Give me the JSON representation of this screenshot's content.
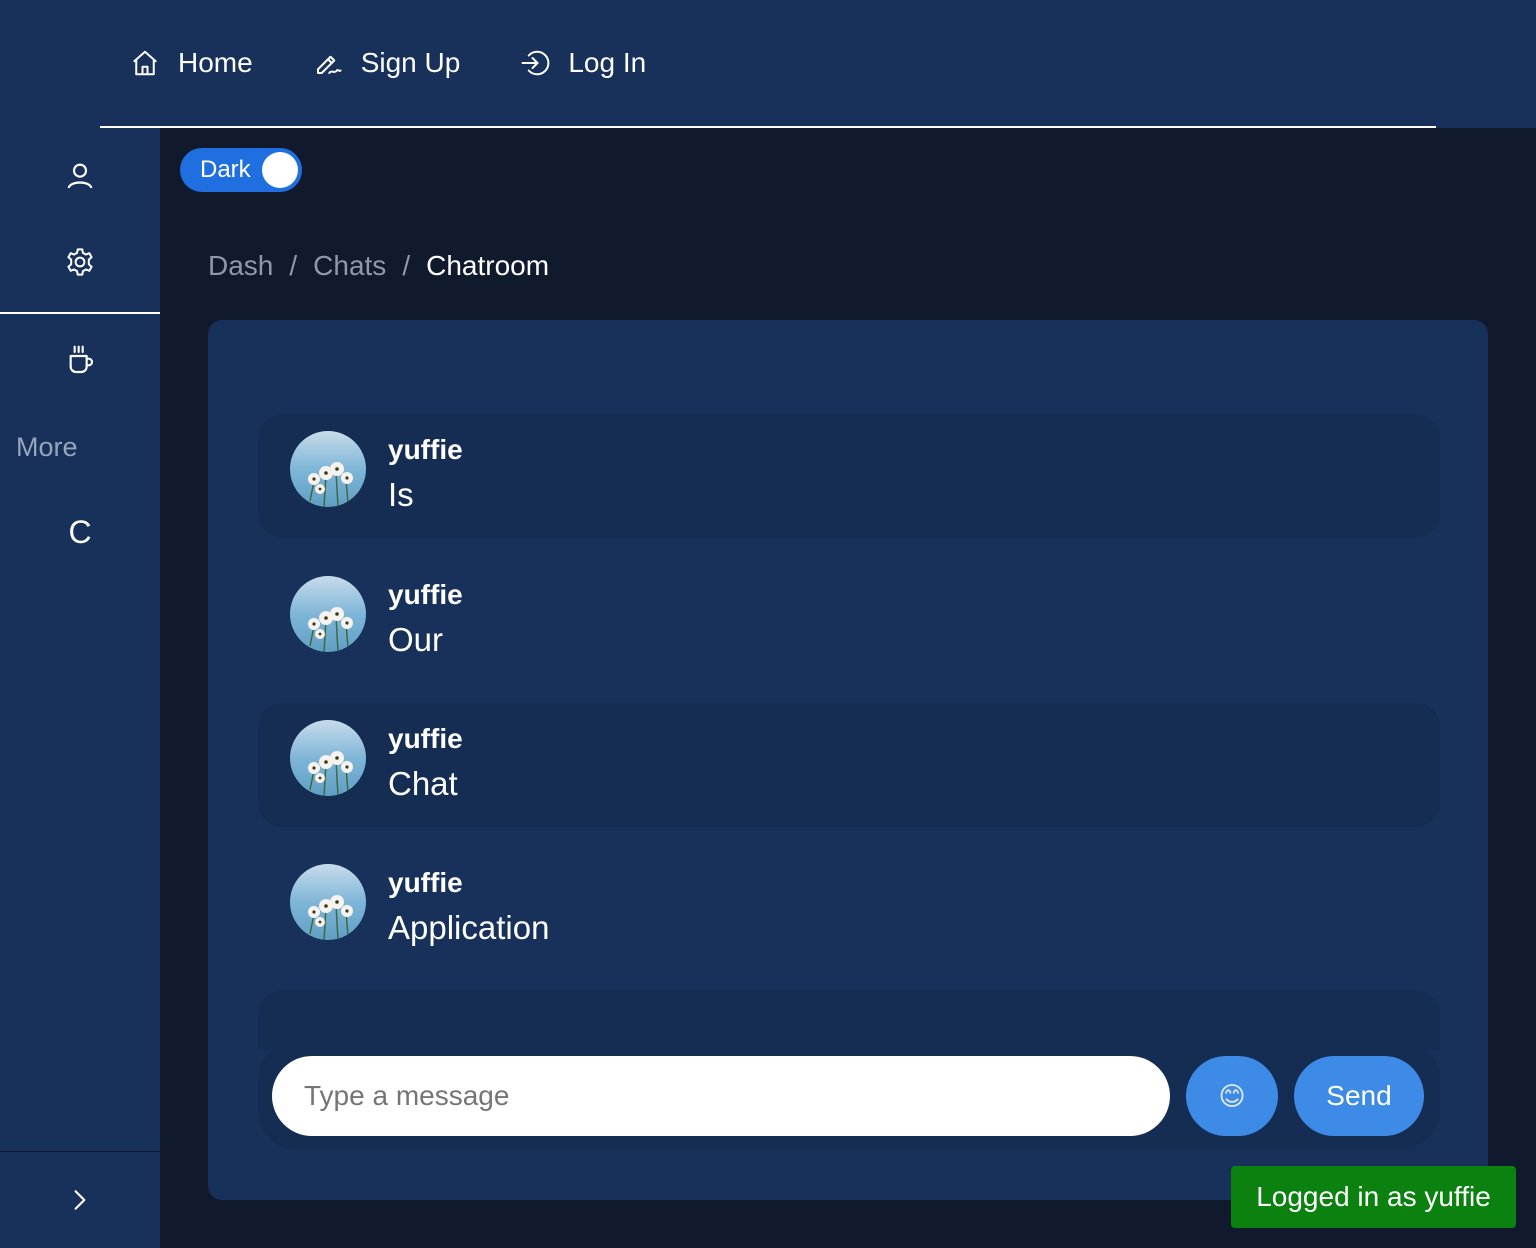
{
  "nav": {
    "items": [
      {
        "label": "Home",
        "icon": "home-icon"
      },
      {
        "label": "Sign Up",
        "icon": "signature-icon"
      },
      {
        "label": "Log In",
        "icon": "login-icon"
      }
    ]
  },
  "sidebar": {
    "icons": [
      "user-icon",
      "gear-icon",
      "coffee-icon"
    ],
    "more_label": "More",
    "letter": "C",
    "expand_icon": "chevron-right-icon"
  },
  "theme_toggle": {
    "label": "Dark",
    "on": true
  },
  "breadcrumb": {
    "items": [
      "Dash",
      "Chats"
    ],
    "separator": "/",
    "current": "Chatroom"
  },
  "chat": {
    "messages": [
      {
        "user": "yuffie",
        "text": "Is"
      },
      {
        "user": "yuffie",
        "text": "Our"
      },
      {
        "user": "yuffie",
        "text": "Chat"
      },
      {
        "user": "yuffie",
        "text": "Application"
      }
    ]
  },
  "composer": {
    "placeholder": "Type a message",
    "emoji": "😊",
    "send_label": "Send"
  },
  "toast": {
    "text": "Logged in as yuffie"
  },
  "colors": {
    "background": "#111a2d",
    "panel": "#17315a",
    "accent": "#3d8be6",
    "toggle": "#1f6fe0",
    "toast": "#0b8110"
  }
}
